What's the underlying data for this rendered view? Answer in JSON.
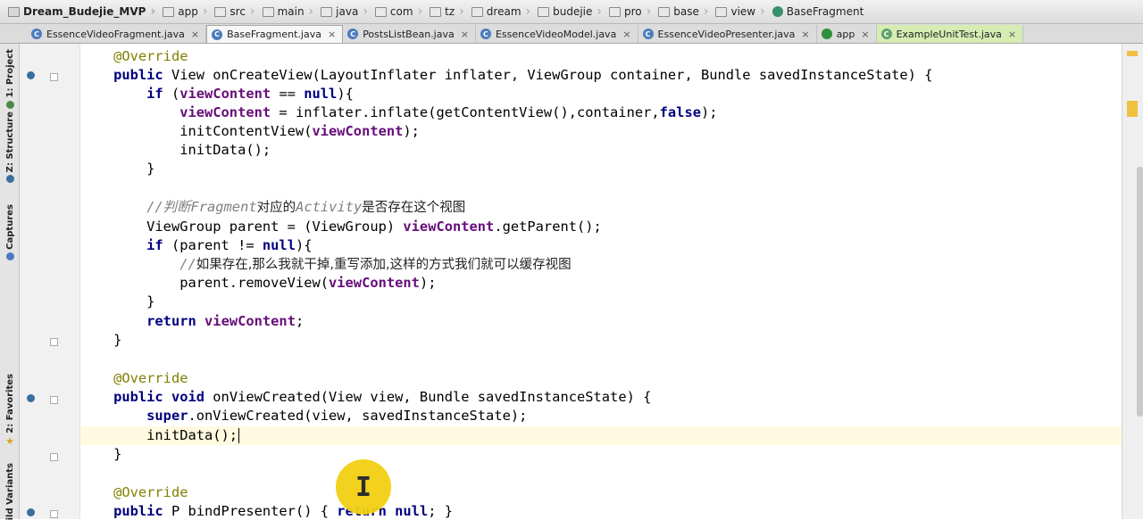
{
  "breadcrumb": [
    {
      "label": "Dream_Budejie_MVP",
      "icon": "project-icon"
    },
    {
      "label": "app",
      "icon": "module-folder-icon"
    },
    {
      "label": "src",
      "icon": "folder-icon"
    },
    {
      "label": "main",
      "icon": "folder-icon"
    },
    {
      "label": "java",
      "icon": "source-folder-icon"
    },
    {
      "label": "com",
      "icon": "package-icon"
    },
    {
      "label": "tz",
      "icon": "package-icon"
    },
    {
      "label": "dream",
      "icon": "package-icon"
    },
    {
      "label": "budejie",
      "icon": "package-icon"
    },
    {
      "label": "pro",
      "icon": "package-icon"
    },
    {
      "label": "base",
      "icon": "package-icon"
    },
    {
      "label": "view",
      "icon": "package-icon"
    },
    {
      "label": "BaseFragment",
      "icon": "class-icon"
    }
  ],
  "tabs": [
    {
      "label": "EssenceVideoFragment.java",
      "close": "×",
      "active": false
    },
    {
      "label": "BaseFragment.java",
      "close": "×",
      "active": true
    },
    {
      "label": "PostsListBean.java",
      "close": "×",
      "active": false
    },
    {
      "label": "EssenceVideoModel.java",
      "close": "×",
      "active": false
    },
    {
      "label": "EssenceVideoPresenter.java",
      "close": "×",
      "active": false
    },
    {
      "label": "app",
      "close": "×",
      "active": false
    },
    {
      "label": "ExampleUnitTest.java",
      "close": "×",
      "active": false,
      "highlighted": true
    }
  ],
  "toolstrip": {
    "project": "1: Project",
    "structure": "Z: Structure",
    "captures": "Captures",
    "favorites": "2: Favorites",
    "variants": "ild Variants"
  },
  "code": {
    "l1": "@Override",
    "l2a": "public",
    "l2b": " View onCreateView(LayoutInflater inflater, ViewGroup container, Bundle savedInstanceState) {",
    "l3a": "if",
    "l3b": " (",
    "l3c": "viewContent",
    "l3d": " == ",
    "l3e": "null",
    "l3f": "){",
    "l4a": "viewContent",
    "l4b": " = inflater.inflate(getContentView(),container,",
    "l4c": "false",
    "l4d": ");",
    "l5a": "initContentView(",
    "l5b": "viewContent",
    "l5c": ");",
    "l6": "initData();",
    "l7": "}",
    "l9a": "//判断",
    "l9b": "Fragment",
    "l9c": "对应的",
    "l9d": "Activity",
    "l9e": "是否存在这个视图",
    "l10a": "ViewGroup parent = (ViewGroup) ",
    "l10b": "viewContent",
    "l10c": ".getParent();",
    "l11a": "if",
    "l11b": " (parent != ",
    "l11c": "null",
    "l11d": "){",
    "l12a": "//",
    "l12b": "如果存在,那么我就干掉,重写添加,这样的方式我们就可以缓存视图",
    "l13a": "parent.removeView(",
    "l13b": "viewContent",
    "l13c": ");",
    "l14": "}",
    "l15a": "return",
    "l15b": " ",
    "l15c": "viewContent",
    "l15d": ";",
    "l16": "}",
    "l18": "@Override",
    "l19a": "public void",
    "l19b": " onViewCreated(View view, Bundle savedInstanceState) {",
    "l20a": "super",
    "l20b": ".onViewCreated(view, savedInstanceState);",
    "l21": "initData();",
    "l22": "}",
    "l24": "@Override",
    "l25a": "public",
    "l25b": " P bindPresenter() { ",
    "l25c": "return null",
    "l25d": "; }"
  },
  "colors": {
    "keyword": "#000080",
    "field": "#660e7a",
    "annotation": "#808000",
    "comment": "#808080",
    "caret_line": "#fffae0",
    "cursor_highlight": "#f2d012"
  }
}
